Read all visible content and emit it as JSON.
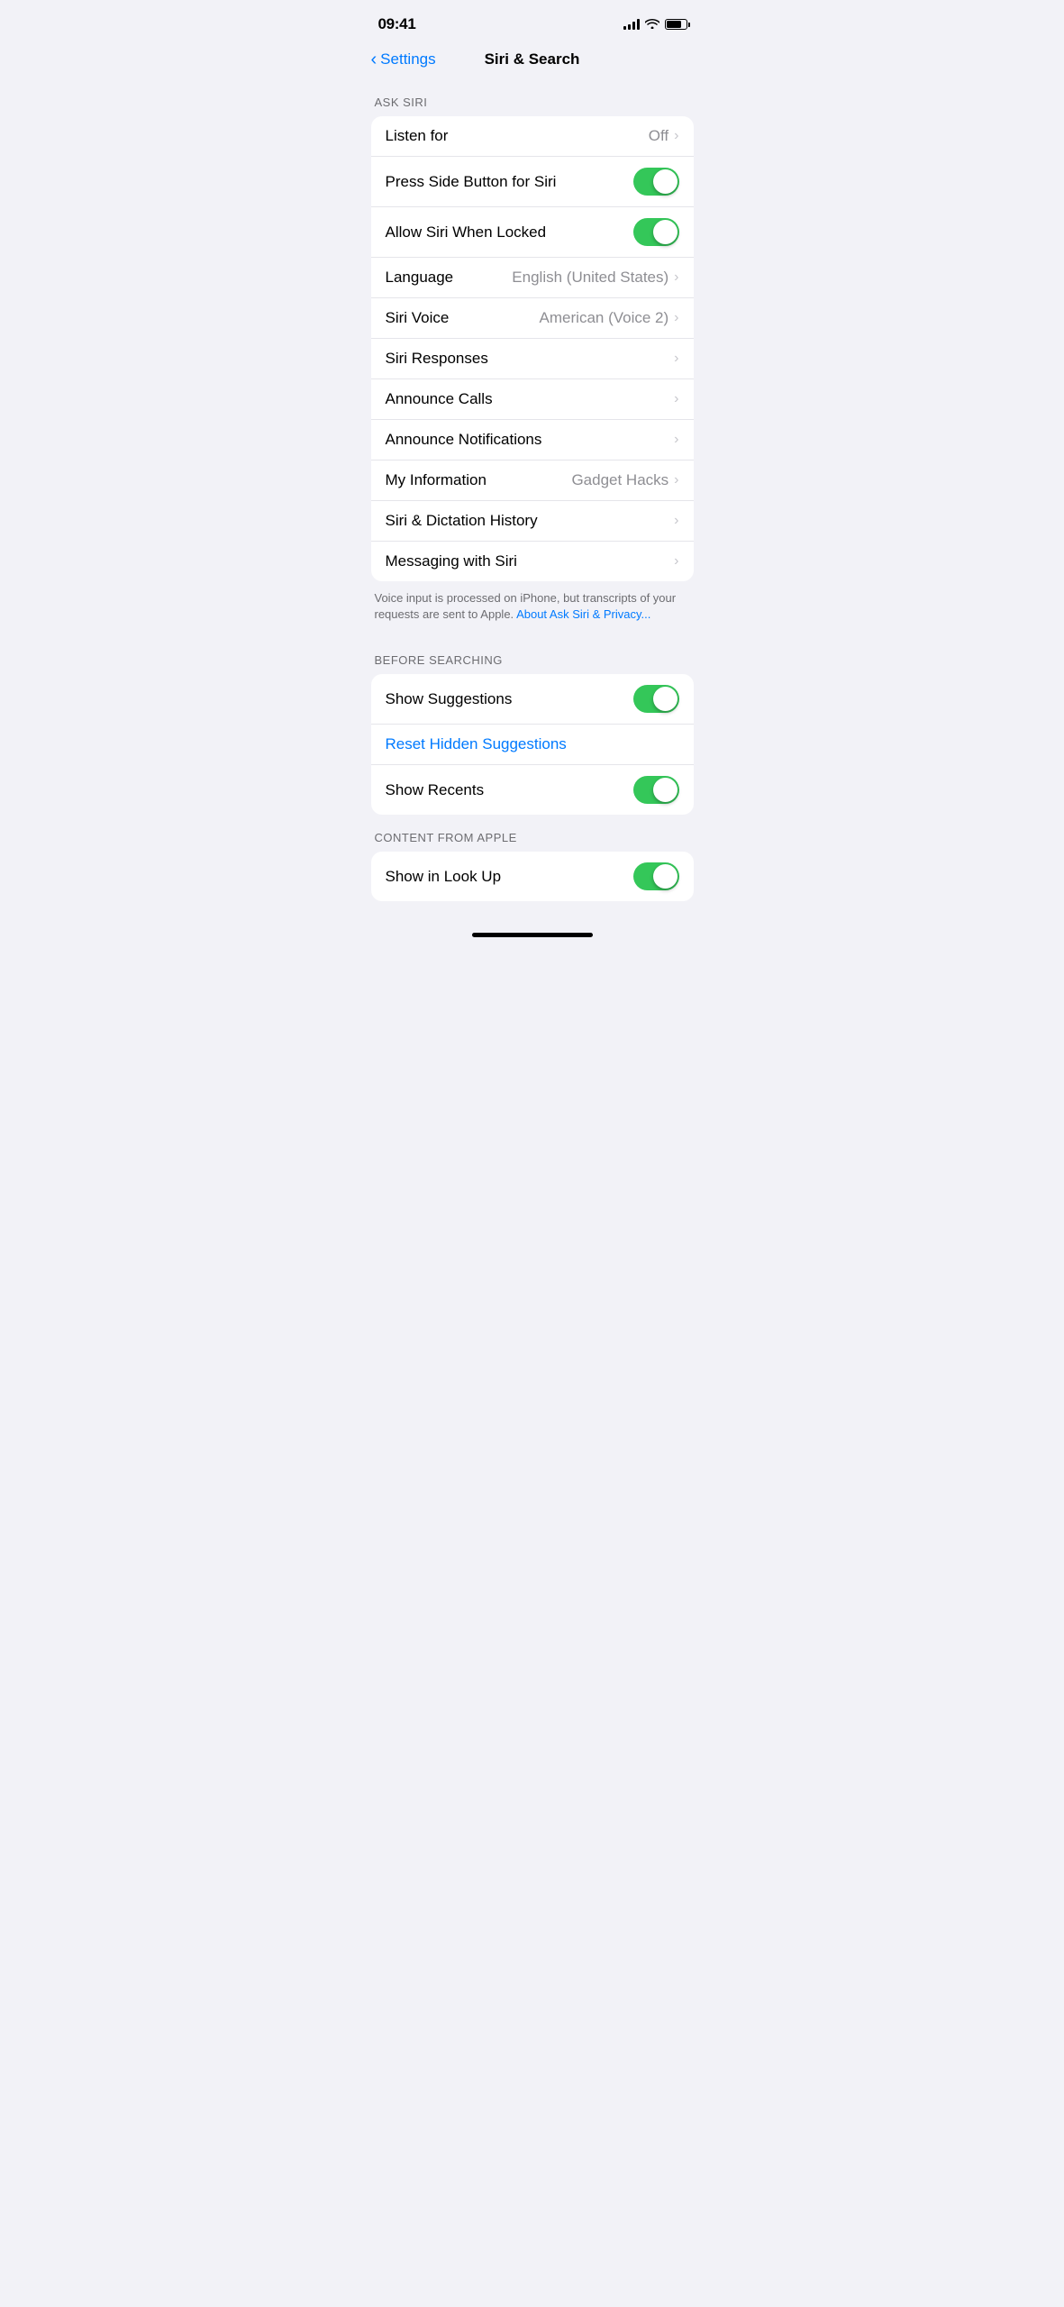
{
  "statusBar": {
    "time": "09:41",
    "battery": 80
  },
  "nav": {
    "backLabel": "Settings",
    "title": "Siri & Search"
  },
  "sections": {
    "askSiri": {
      "label": "ASK SIRI",
      "rows": [
        {
          "id": "listen-for",
          "label": "Listen for",
          "value": "Off",
          "type": "chevron"
        },
        {
          "id": "press-side-button",
          "label": "Press Side Button for Siri",
          "type": "toggle",
          "on": true
        },
        {
          "id": "allow-when-locked",
          "label": "Allow Siri When Locked",
          "type": "toggle",
          "on": true
        },
        {
          "id": "language",
          "label": "Language",
          "value": "English (United States)",
          "type": "chevron"
        },
        {
          "id": "siri-voice",
          "label": "Siri Voice",
          "value": "American (Voice 2)",
          "type": "chevron"
        },
        {
          "id": "siri-responses",
          "label": "Siri Responses",
          "type": "chevron-only"
        },
        {
          "id": "announce-calls",
          "label": "Announce Calls",
          "type": "chevron-only"
        },
        {
          "id": "announce-notifications",
          "label": "Announce Notifications",
          "type": "chevron-only"
        },
        {
          "id": "my-information",
          "label": "My Information",
          "value": "Gadget Hacks",
          "type": "chevron"
        },
        {
          "id": "siri-dictation-history",
          "label": "Siri & Dictation History",
          "type": "chevron-only"
        },
        {
          "id": "messaging-with-siri",
          "label": "Messaging with Siri",
          "type": "chevron-only"
        }
      ],
      "footer": {
        "text": "Voice input is processed on iPhone, but transcripts of your requests are sent to Apple. ",
        "linkText": "About Ask Siri & Privacy...",
        "linkHref": "#"
      }
    },
    "beforeSearching": {
      "label": "BEFORE SEARCHING",
      "rows": [
        {
          "id": "show-suggestions",
          "label": "Show Suggestions",
          "type": "toggle",
          "on": true
        },
        {
          "id": "reset-hidden-suggestions",
          "label": "Reset Hidden Suggestions",
          "type": "link"
        },
        {
          "id": "show-recents",
          "label": "Show Recents",
          "type": "toggle",
          "on": true
        }
      ]
    },
    "contentFromApple": {
      "label": "CONTENT FROM APPLE",
      "rows": [
        {
          "id": "show-in-look-up",
          "label": "Show in Look Up",
          "type": "toggle",
          "on": true
        }
      ]
    }
  }
}
